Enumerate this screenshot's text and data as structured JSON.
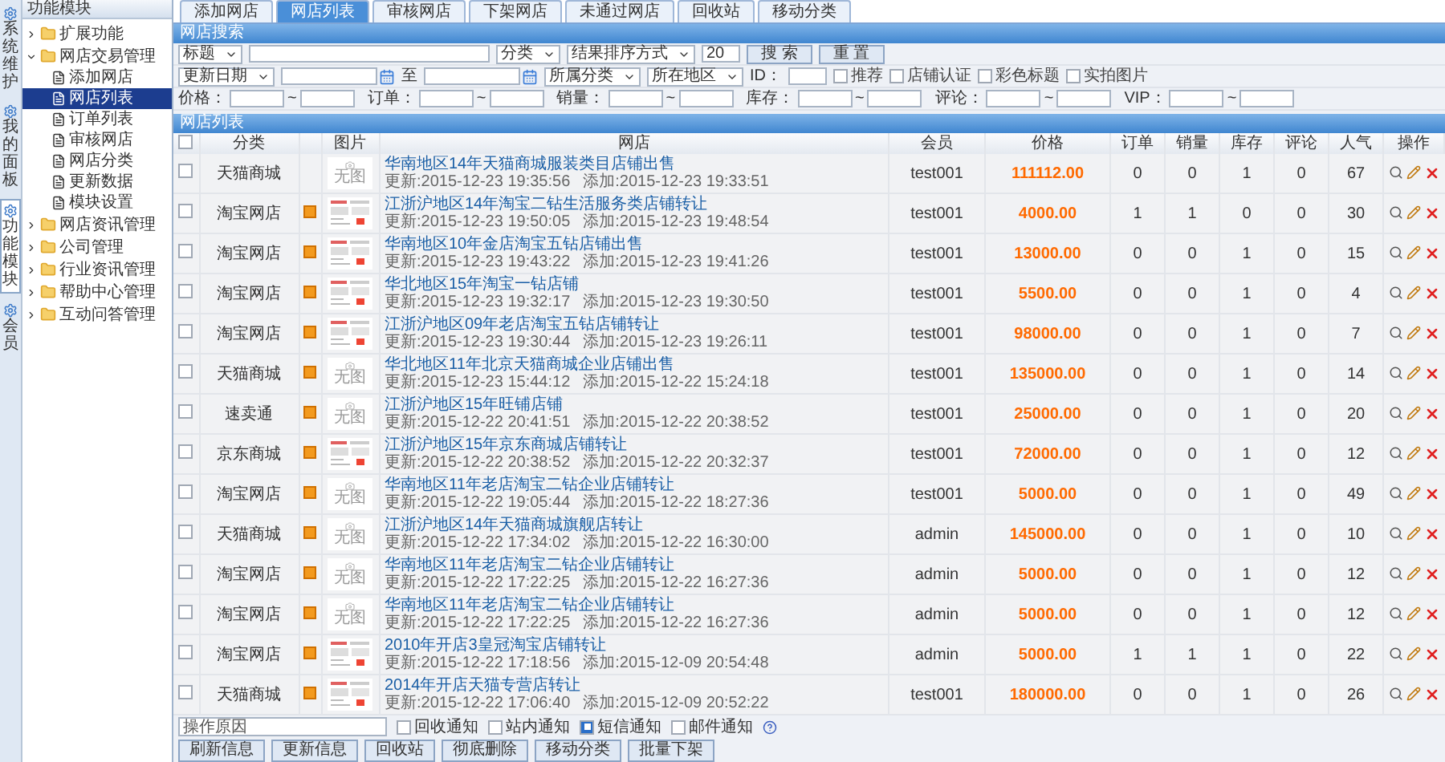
{
  "sidebar": {
    "title": "功能模块",
    "strip": [
      {
        "label": "系统维护",
        "selected": false
      },
      {
        "label": "我的面板",
        "selected": false
      },
      {
        "label": "功能模块",
        "selected": true
      },
      {
        "label": "会员",
        "selected": false
      }
    ],
    "tree": [
      {
        "label": "扩展功能",
        "expanded": false
      },
      {
        "label": "网店交易管理",
        "expanded": true,
        "children": [
          {
            "label": "添加网店",
            "selected": false
          },
          {
            "label": "网店列表",
            "selected": true
          },
          {
            "label": "订单列表",
            "selected": false
          },
          {
            "label": "审核网店",
            "selected": false
          },
          {
            "label": "网店分类",
            "selected": false
          },
          {
            "label": "更新数据",
            "selected": false
          },
          {
            "label": "模块设置",
            "selected": false
          }
        ]
      },
      {
        "label": "网店资讯管理",
        "expanded": false
      },
      {
        "label": "公司管理",
        "expanded": false
      },
      {
        "label": "行业资讯管理",
        "expanded": false
      },
      {
        "label": "帮助中心管理",
        "expanded": false
      },
      {
        "label": "互动问答管理",
        "expanded": false
      }
    ]
  },
  "tabs": [
    {
      "label": "添加网店",
      "selected": false
    },
    {
      "label": "网店列表",
      "selected": true
    },
    {
      "label": "审核网店",
      "selected": false
    },
    {
      "label": "下架网店",
      "selected": false
    },
    {
      "label": "未通过网店",
      "selected": false
    },
    {
      "label": "回收站",
      "selected": false
    },
    {
      "label": "移动分类",
      "selected": false
    }
  ],
  "search": {
    "title": "网店搜索",
    "lines": [
      {
        "items": [
          {
            "kind": "select",
            "value": "标题"
          },
          {
            "kind": "wideinput"
          },
          {
            "kind": "select",
            "value": "分类"
          },
          {
            "kind": "select",
            "value": "结果排序方式"
          },
          {
            "kind": "input",
            "value": "20"
          },
          {
            "kind": "button",
            "label": "搜 索"
          },
          {
            "kind": "button",
            "label": "重 置"
          }
        ]
      },
      {
        "items": [
          {
            "kind": "select",
            "value": "更新日期"
          },
          {
            "kind": "date"
          },
          {
            "kind": "text",
            "label": "至"
          },
          {
            "kind": "date"
          },
          {
            "kind": "select",
            "value": "所属分类"
          },
          {
            "kind": "select",
            "value": "所在地区"
          },
          {
            "kind": "text",
            "label": "ID："
          },
          {
            "kind": "input"
          },
          {
            "kind": "checkbox",
            "label": "推荐",
            "checked": false
          },
          {
            "kind": "checkbox",
            "label": "店铺认证",
            "checked": false
          },
          {
            "kind": "checkbox",
            "label": "彩色标题",
            "checked": false
          },
          {
            "kind": "checkbox",
            "label": "实拍图片",
            "checked": false
          }
        ]
      },
      {
        "items": [
          {
            "kind": "range",
            "label": "价格：",
            "sep": "~"
          },
          {
            "kind": "range",
            "label": "订单：",
            "sep": "~"
          },
          {
            "kind": "range",
            "label": "销量：",
            "sep": "~"
          },
          {
            "kind": "range",
            "label": "库存：",
            "sep": "~"
          },
          {
            "kind": "range",
            "label": "评论：",
            "sep": "~"
          },
          {
            "kind": "range",
            "label": "VIP：",
            "sep": "~"
          }
        ]
      }
    ]
  },
  "list": {
    "title": "网店列表",
    "select_all": {
      "checked": false
    },
    "columns": [
      "分类",
      "图片",
      "网店",
      "会员",
      "价格",
      "订单",
      "销量",
      "库存",
      "评论",
      "人气",
      "操作"
    ],
    "rows": [
      {
        "checked": false,
        "category": "天猫商城",
        "flag": false,
        "image": {
          "kind": "none",
          "label": "无图"
        },
        "title": "华南地区14年天猫商城服装类目店铺出售",
        "updated": "更新:2015-12-23 19:35:56",
        "added": "添加:2015-12-23 19:33:51",
        "member": "test001",
        "price": "111112.00",
        "orders": "0",
        "sales": "0",
        "stock": "1",
        "comments": "0",
        "views": "67"
      },
      {
        "checked": false,
        "category": "淘宝网店",
        "flag": true,
        "title": "江浙沪地区14年淘宝二钻生活服务类店铺转让",
        "updated": "更新:2015-12-23 19:50:05",
        "added": "添加:2015-12-23 19:48:54",
        "member": "test001",
        "price": "4000.00",
        "orders": "1",
        "sales": "1",
        "stock": "0",
        "comments": "0",
        "views": "30"
      },
      {
        "checked": false,
        "category": "淘宝网店",
        "flag": true,
        "title": "华南地区10年金店淘宝五钻店铺出售",
        "updated": "更新:2015-12-23 19:43:22",
        "added": "添加:2015-12-23 19:41:26",
        "member": "test001",
        "price": "13000.00",
        "orders": "0",
        "sales": "0",
        "stock": "1",
        "comments": "0",
        "views": "15"
      },
      {
        "checked": false,
        "category": "淘宝网店",
        "flag": true,
        "title": "华北地区15年淘宝一钻店铺",
        "updated": "更新:2015-12-23 19:32:17",
        "added": "添加:2015-12-23 19:30:50",
        "member": "test001",
        "price": "5500.00",
        "orders": "0",
        "sales": "0",
        "stock": "1",
        "comments": "0",
        "views": "4"
      },
      {
        "checked": false,
        "category": "淘宝网店",
        "flag": true,
        "title": "江浙沪地区09年老店淘宝五钻店铺转让",
        "updated": "更新:2015-12-23 19:30:44",
        "added": "添加:2015-12-23 19:26:11",
        "member": "test001",
        "price": "98000.00",
        "orders": "0",
        "sales": "0",
        "stock": "1",
        "comments": "0",
        "views": "7"
      },
      {
        "checked": false,
        "category": "天猫商城",
        "flag": true,
        "image": {
          "kind": "none",
          "label": "无图"
        },
        "title": "华北地区11年北京天猫商城企业店铺出售",
        "updated": "更新:2015-12-23 15:44:12",
        "added": "添加:2015-12-22 15:24:18",
        "member": "test001",
        "price": "135000.00",
        "orders": "0",
        "sales": "0",
        "stock": "1",
        "comments": "0",
        "views": "14"
      },
      {
        "checked": false,
        "category": "速卖通",
        "flag": true,
        "image": {
          "kind": "none",
          "label": "无图"
        },
        "title": "江浙沪地区15年旺铺店铺",
        "updated": "更新:2015-12-22 20:41:51",
        "added": "添加:2015-12-22 20:38:52",
        "member": "test001",
        "price": "25000.00",
        "orders": "0",
        "sales": "0",
        "stock": "1",
        "comments": "0",
        "views": "20"
      },
      {
        "checked": false,
        "category": "京东商城",
        "flag": true,
        "title": "江浙沪地区15年京东商城店铺转让",
        "updated": "更新:2015-12-22 20:38:52",
        "added": "添加:2015-12-22 20:32:37",
        "member": "test001",
        "price": "72000.00",
        "orders": "0",
        "sales": "0",
        "stock": "1",
        "comments": "0",
        "views": "12"
      },
      {
        "checked": false,
        "category": "淘宝网店",
        "flag": true,
        "image": {
          "kind": "none",
          "label": "无图"
        },
        "title": "华南地区11年老店淘宝二钻企业店铺转让",
        "updated": "更新:2015-12-22 19:05:44",
        "added": "添加:2015-12-22 18:27:36",
        "member": "test001",
        "price": "5000.00",
        "orders": "0",
        "sales": "0",
        "stock": "1",
        "comments": "0",
        "views": "49"
      },
      {
        "checked": false,
        "category": "天猫商城",
        "flag": true,
        "image": {
          "kind": "none",
          "label": "无图"
        },
        "title": "江浙沪地区14年天猫商城旗舰店转让",
        "updated": "更新:2015-12-22 17:34:02",
        "added": "添加:2015-12-22 16:30:00",
        "member": "admin",
        "price": "145000.00",
        "orders": "0",
        "sales": "0",
        "stock": "1",
        "comments": "0",
        "views": "10"
      },
      {
        "checked": false,
        "category": "淘宝网店",
        "flag": true,
        "image": {
          "kind": "none",
          "label": "无图"
        },
        "title": "华南地区11年老店淘宝二钻企业店铺转让",
        "updated": "更新:2015-12-22 17:22:25",
        "added": "添加:2015-12-22 16:27:36",
        "member": "admin",
        "price": "5000.00",
        "orders": "0",
        "sales": "0",
        "stock": "1",
        "comments": "0",
        "views": "12"
      },
      {
        "checked": false,
        "category": "淘宝网店",
        "flag": true,
        "image": {
          "kind": "none",
          "label": "无图"
        },
        "title": "华南地区11年老店淘宝二钻企业店铺转让",
        "updated": "更新:2015-12-22 17:22:25",
        "added": "添加:2015-12-22 16:27:36",
        "member": "admin",
        "price": "5000.00",
        "orders": "0",
        "sales": "0",
        "stock": "1",
        "comments": "0",
        "views": "12"
      },
      {
        "checked": false,
        "category": "淘宝网店",
        "flag": true,
        "title": "2010年开店3皇冠淘宝店铺转让",
        "updated": "更新:2015-12-22 17:18:56",
        "added": "添加:2015-12-09 20:54:48",
        "member": "admin",
        "price": "5000.00",
        "orders": "1",
        "sales": "1",
        "stock": "1",
        "comments": "0",
        "views": "22"
      },
      {
        "checked": false,
        "category": "天猫商城",
        "flag": true,
        "title": "2014年开店天猫专营店转让",
        "updated": "更新:2015-12-22 17:06:40",
        "added": "添加:2015-12-09 20:52:22",
        "member": "test001",
        "price": "180000.00",
        "orders": "0",
        "sales": "0",
        "stock": "1",
        "comments": "0",
        "views": "26"
      }
    ]
  },
  "footer": {
    "reason": {
      "placeholder": "操作原因"
    },
    "notices": [
      {
        "label": "回收通知",
        "checked": false
      },
      {
        "label": "站内通知",
        "checked": false
      },
      {
        "label": "短信通知",
        "checked": true
      },
      {
        "label": "邮件通知",
        "checked": false
      }
    ],
    "buttons": [
      "刷新信息",
      "更新信息",
      "回收站",
      "彻底删除",
      "移动分类",
      "批量下架"
    ]
  }
}
